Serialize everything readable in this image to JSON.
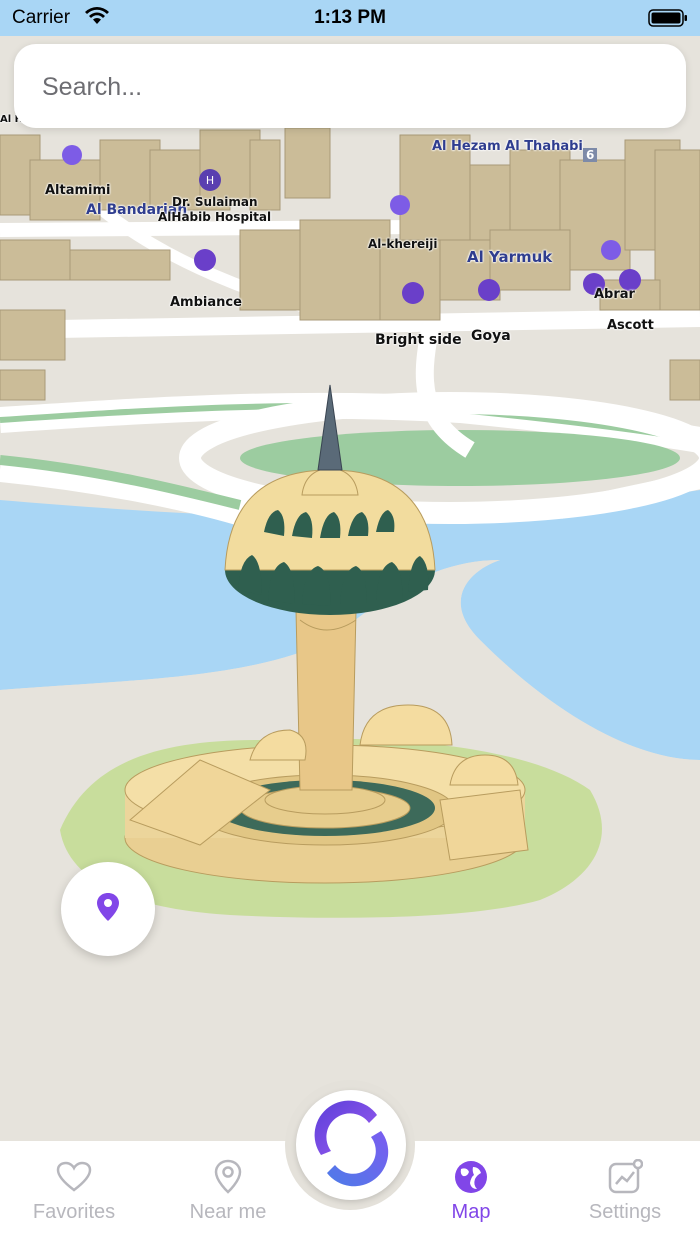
{
  "status_bar": {
    "carrier": "Carrier",
    "time": "1:13 PM"
  },
  "search": {
    "placeholder": "Search..."
  },
  "map_labels": {
    "al_ha": "Al Ha",
    "altamimi": "Altamimi",
    "al_bandariah": "Al Bandariah",
    "dr_sulaiman": "Dr. Sulaiman",
    "alhabib_hospital": "AlHabib Hospital",
    "al_hezam": "Al Hezam Al Thahabi",
    "six": "6",
    "al_khereiji": "Al-khereiji",
    "al_yarmuk": "Al Yarmuk",
    "abrar": "Abrar",
    "ambiance": "Ambiance",
    "ascott": "Ascott",
    "bright_side": "Bright side",
    "goya": "Goya"
  },
  "icons": {
    "wifi": "wifi-icon",
    "battery": "battery-icon",
    "location_pin": "location-pin-icon",
    "favorites": "heart-icon",
    "near_me": "map-pin-icon",
    "map": "globe-icon",
    "settings": "chart-icon",
    "center_logo": "logo-icon"
  },
  "tabs": [
    {
      "label": "Favorites",
      "active": false
    },
    {
      "label": "Near me",
      "active": false
    },
    {
      "label": "Map",
      "active": true
    },
    {
      "label": "Settings",
      "active": false
    }
  ],
  "colors": {
    "accent": "#8146e8",
    "water": "#a9d6f5",
    "land": "#e6e3dc",
    "park": "#c8dd9c",
    "road_green": "#9ccca0"
  }
}
